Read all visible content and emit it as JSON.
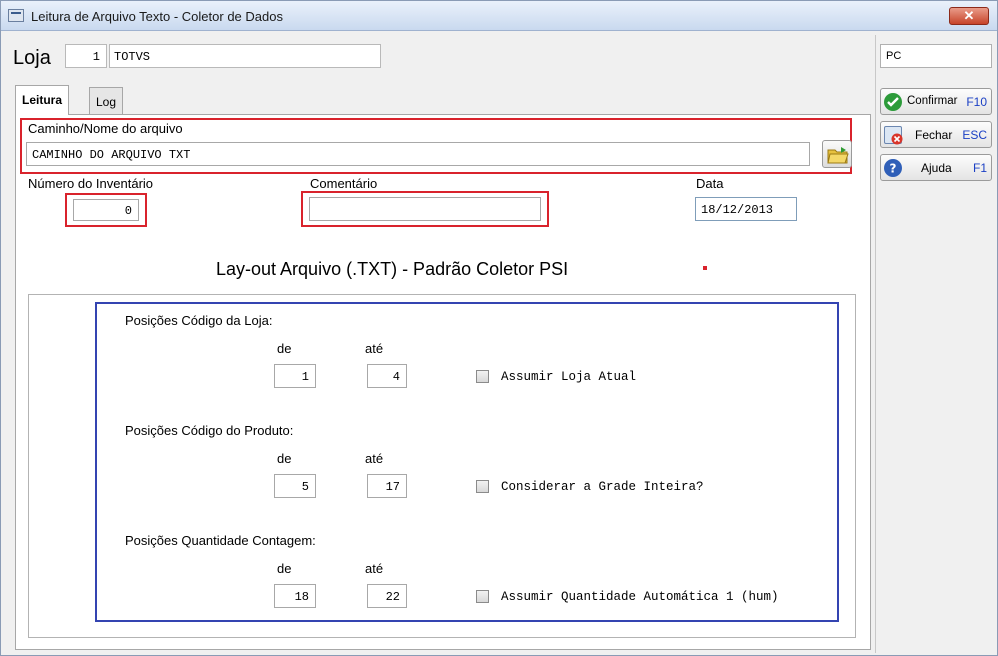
{
  "window": {
    "title": "Leitura de Arquivo Texto - Coletor de Dados",
    "close_label": "✕"
  },
  "loja": {
    "label": "Loja",
    "code": "1",
    "name": "TOTVS"
  },
  "tabs": [
    {
      "label": "Leitura",
      "active": true
    },
    {
      "label": "Log",
      "active": false
    }
  ],
  "file": {
    "label": "Caminho/Nome do arquivo",
    "value": "CAMINHO DO ARQUIVO TXT"
  },
  "inventario": {
    "label": "Número do Inventário",
    "value": "0"
  },
  "comentario": {
    "label": "Comentário",
    "value": ""
  },
  "data": {
    "label": "Data",
    "value": "18/12/2013"
  },
  "layout_title": "Lay-out Arquivo (.TXT) - Padrão Coletor PSI",
  "sections": {
    "loja": {
      "title": "Posições Código da Loja:",
      "de_label": "de",
      "ate_label": "até",
      "de": "1",
      "ate": "4",
      "check_label": "Assumir Loja Atual"
    },
    "produto": {
      "title": "Posições Código do Produto:",
      "de_label": "de",
      "ate_label": "até",
      "de": "5",
      "ate": "17",
      "check_label": "Considerar a Grade Inteira?"
    },
    "quantidade": {
      "title": "Posições Quantidade Contagem:",
      "de_label": "de",
      "ate_label": "até",
      "de": "18",
      "ate": "22",
      "check_label": "Assumir Quantidade Automática 1 (hum)"
    }
  },
  "side": {
    "pc": "PC",
    "confirmar": {
      "label": "Confirmar",
      "key": "F10"
    },
    "fechar": {
      "label": "Fechar",
      "key": "ESC"
    },
    "ajuda": {
      "label": "Ajuda",
      "key": "F1"
    }
  },
  "colors": {
    "highlight_red": "#d9232c",
    "highlight_blue": "#3444b1",
    "shortcut_blue": "#1a3fc4"
  }
}
